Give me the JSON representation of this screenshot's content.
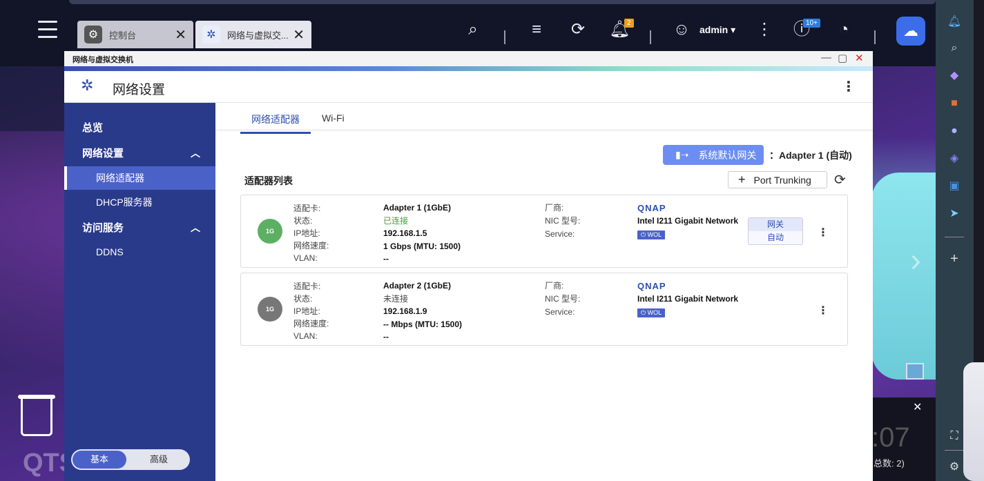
{
  "taskbar": {
    "tabs": [
      {
        "label": "控制台",
        "icon": "gear-icon"
      },
      {
        "label": "网络与虚拟交...",
        "icon": "network-icon"
      }
    ],
    "notification_count": "2",
    "admin_label": "admin ▾",
    "info_badge": "10+"
  },
  "window": {
    "title": "网络与虚拟交换机",
    "app_title": "网络设置"
  },
  "sidebar": {
    "items": [
      {
        "label": "总览"
      },
      {
        "label": "网络设置"
      },
      {
        "label": "网络适配器"
      },
      {
        "label": "DHCP服务器"
      },
      {
        "label": "访问服务"
      },
      {
        "label": "DDNS"
      }
    ],
    "mode_basic": "基本",
    "mode_advanced": "高级"
  },
  "main": {
    "tabs": [
      {
        "label": "网络适配器"
      },
      {
        "label": "Wi-Fi"
      }
    ],
    "gateway_button": "系统默认网关",
    "gateway_value": "：Adapter 1 (自动)",
    "list_title": "适配器列表",
    "port_trunking": "Port Trunking",
    "labels": {
      "card": "适配卡:",
      "status": "状态:",
      "ip": "IP地址:",
      "speed": "网络速度:",
      "vlan": "VLAN:",
      "vendor": "厂商:",
      "nic_model": "NIC 型号:",
      "service": "Service:"
    },
    "adapters": [
      {
        "name": "Adapter 1 (1GbE)",
        "status": "已连接",
        "ip": "192.168.1.5",
        "speed": "1 Gbps (MTU: 1500)",
        "vlan": "--",
        "vendor": "QNAP",
        "nic": "Intel I211 Gigabit Network",
        "wol": "⏻ WOL",
        "port_label": "1G",
        "gateway_badge": "网关",
        "gateway_mode": "自动"
      },
      {
        "name": "Adapter 2 (1GbE)",
        "status": "未连接",
        "ip": "192.168.1.9",
        "speed": "-- Mbps (MTU: 1500)",
        "vlan": "--",
        "vendor": "QNAP",
        "nic": "Intel I211 Gigabit Network",
        "wol": "⏻ WOL",
        "port_label": "1G"
      }
    ]
  },
  "desktop": {
    "brand": "QTS",
    "clock_fragment": ":07",
    "notification_total": "总数: 2)"
  },
  "colors": {
    "accent": "#2b4fb0",
    "sidebar": "#2a3a8a",
    "connected": "#3aa33a",
    "gateway_button": "#6d8ef0"
  }
}
